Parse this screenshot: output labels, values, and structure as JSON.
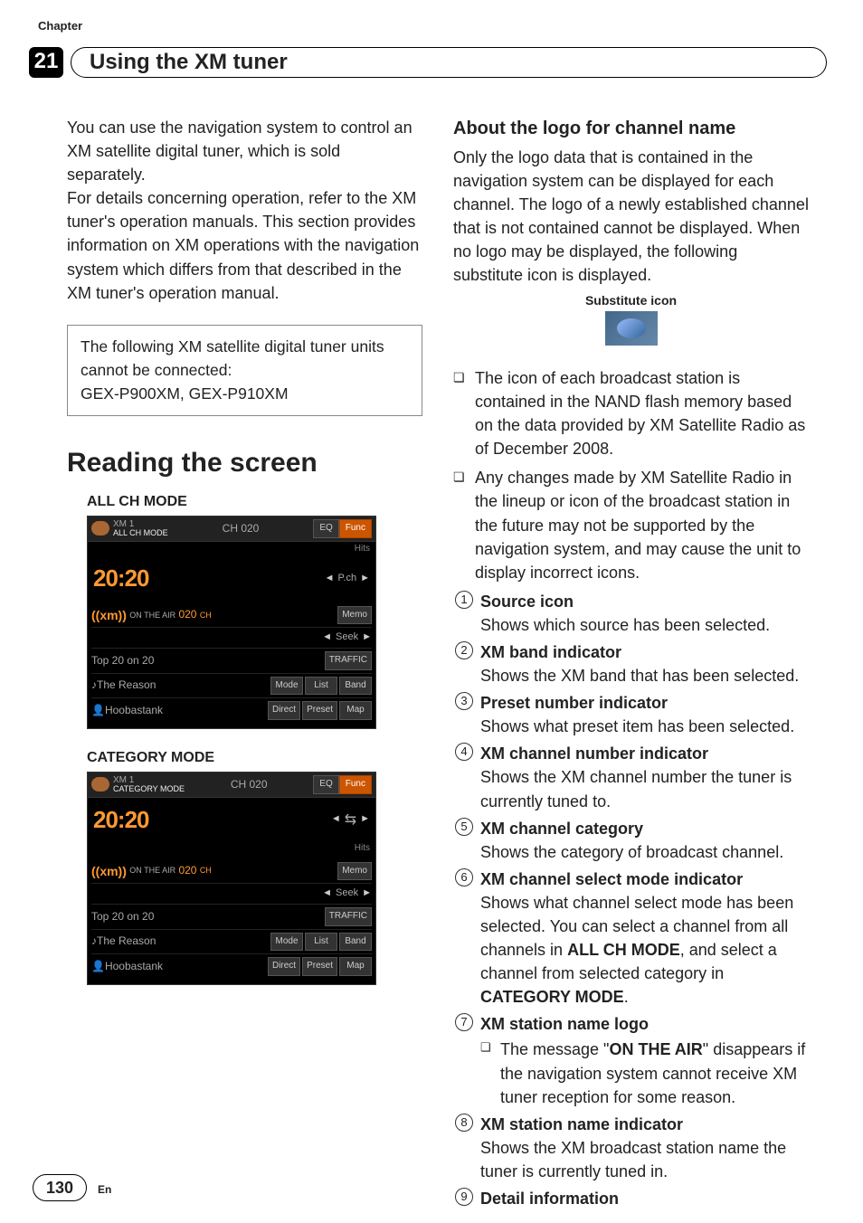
{
  "header": {
    "chapter_label": "Chapter",
    "chapter_number": "21",
    "title": "Using the XM tuner"
  },
  "left": {
    "intro_p1": "You can use the navigation system to control an XM satellite digital tuner, which is sold separately.",
    "intro_p2": "For details concerning operation, refer to the XM tuner's operation manuals. This section provides information on XM operations with the navigation system which differs from that described in the XM tuner's operation manual.",
    "box_line1": "The following XM satellite digital tuner units cannot be connected:",
    "box_line2": "GEX-P900XM, GEX-P910XM",
    "section_heading": "Reading the screen",
    "mode1_label": "ALL CH MODE",
    "mode2_label": "CATEGORY MODE",
    "shot": {
      "xm": "XM 1",
      "mode1": "ALL CH MODE",
      "mode2": "CATEGORY MODE",
      "ch": "CH 020",
      "eq": "EQ",
      "func": "Func",
      "hits": "Hits",
      "clock": "20:20",
      "pch": "P.ch",
      "radio_brand": "((xm))",
      "on_air": "ON THE AIR",
      "ch_big": "020",
      "ch_suffix": "CH",
      "memo": "Memo",
      "seek": "Seek",
      "traffic": "TRAFFIC",
      "station": "Top 20 on 20",
      "song": "The Reason",
      "artist": "Hoobastank",
      "mode": "Mode",
      "list": "List",
      "band": "Band",
      "direct": "Direct",
      "preset": "Preset",
      "map": "Map"
    }
  },
  "right": {
    "h3": "About the logo for channel name",
    "para": "Only the logo data that is contained in the navigation system can be displayed for each channel. The logo of a newly established channel that is not contained cannot be displayed. When no logo may be displayed, the following substitute icon is displayed.",
    "sub_icon_caption": "Substitute icon",
    "bullets": [
      "The icon of each broadcast station is contained in the NAND flash memory based on the data provided by XM Satellite Radio as of December 2008.",
      "Any changes made by XM Satellite Radio in the lineup or icon of the broadcast station in the future may not be supported by the navigation system, and may cause the unit to display incorrect icons."
    ],
    "items": [
      {
        "head": "Source icon",
        "body": "Shows which source has been selected."
      },
      {
        "head": "XM band indicator",
        "body": "Shows the XM band that has been selected."
      },
      {
        "head": "Preset number indicator",
        "body": "Shows what preset item has been selected."
      },
      {
        "head": "XM channel number indicator",
        "body": "Shows the XM channel number the tuner is currently tuned to."
      },
      {
        "head": "XM channel category",
        "body": "Shows the category of broadcast channel."
      },
      {
        "head": "XM channel select mode indicator",
        "body": "Shows what channel select mode has been selected. You can select a channel from all channels in ALL CH MODE, and select a channel from selected category in CATEGORY MODE."
      },
      {
        "head": "XM station name logo",
        "nested": "The message \"ON THE AIR\" disappears if the navigation system cannot receive XM tuner reception for some reason."
      },
      {
        "head": "XM station name indicator",
        "body": "Shows the XM broadcast station name the tuner is currently tuned in."
      },
      {
        "head": "Detail information"
      }
    ]
  },
  "footer": {
    "page": "130",
    "lang": "En"
  }
}
